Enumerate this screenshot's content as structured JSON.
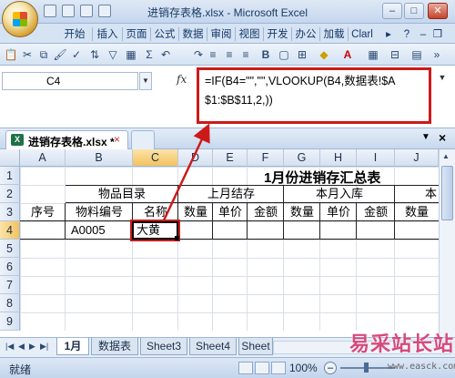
{
  "app": {
    "title": "进销存表格.xlsx - Microsoft Excel"
  },
  "ribbon_tabs": [
    "开始",
    "插入",
    "页面",
    "公式",
    "数据",
    "审阅",
    "视图",
    "开发",
    "办公",
    "加载",
    "Clarl"
  ],
  "formula_bar": {
    "name_box": "C4",
    "fx_label": "fx",
    "formula": "=IF(B4=\"\",\"\",VLOOKUP(B4,数据表!$A$1:$B$11,2,))"
  },
  "workbook": {
    "tab_label": "进销存表格.xlsx *",
    "close_label": "×"
  },
  "columns": [
    "A",
    "B",
    "C",
    "D",
    "E",
    "F",
    "G",
    "H",
    "I",
    "J"
  ],
  "rows": [
    "1",
    "2",
    "3",
    "4",
    "5",
    "6",
    "7",
    "8",
    "9"
  ],
  "sheet": {
    "title": "1月份进销存汇总表",
    "header_groups": [
      "物品目录",
      "上月结存",
      "本月入库",
      "本"
    ],
    "headers": [
      "序号",
      "物料编号",
      "名称",
      "数量",
      "单价",
      "金额",
      "数量",
      "单价",
      "金额",
      "数量"
    ],
    "row4": {
      "B": "A0005",
      "C": "大黄"
    }
  },
  "sheet_tabs": [
    "1月",
    "数据表",
    "Sheet3",
    "Sheet4",
    "Sheet"
  ],
  "status": {
    "ready": "就绪",
    "zoom": "100%"
  },
  "watermark": {
    "brand": "易采站长站",
    "url": "www.easck.com"
  },
  "colors": {
    "highlight_red": "#cc1a1a",
    "ribbon_blue": "#d6e3f3"
  }
}
